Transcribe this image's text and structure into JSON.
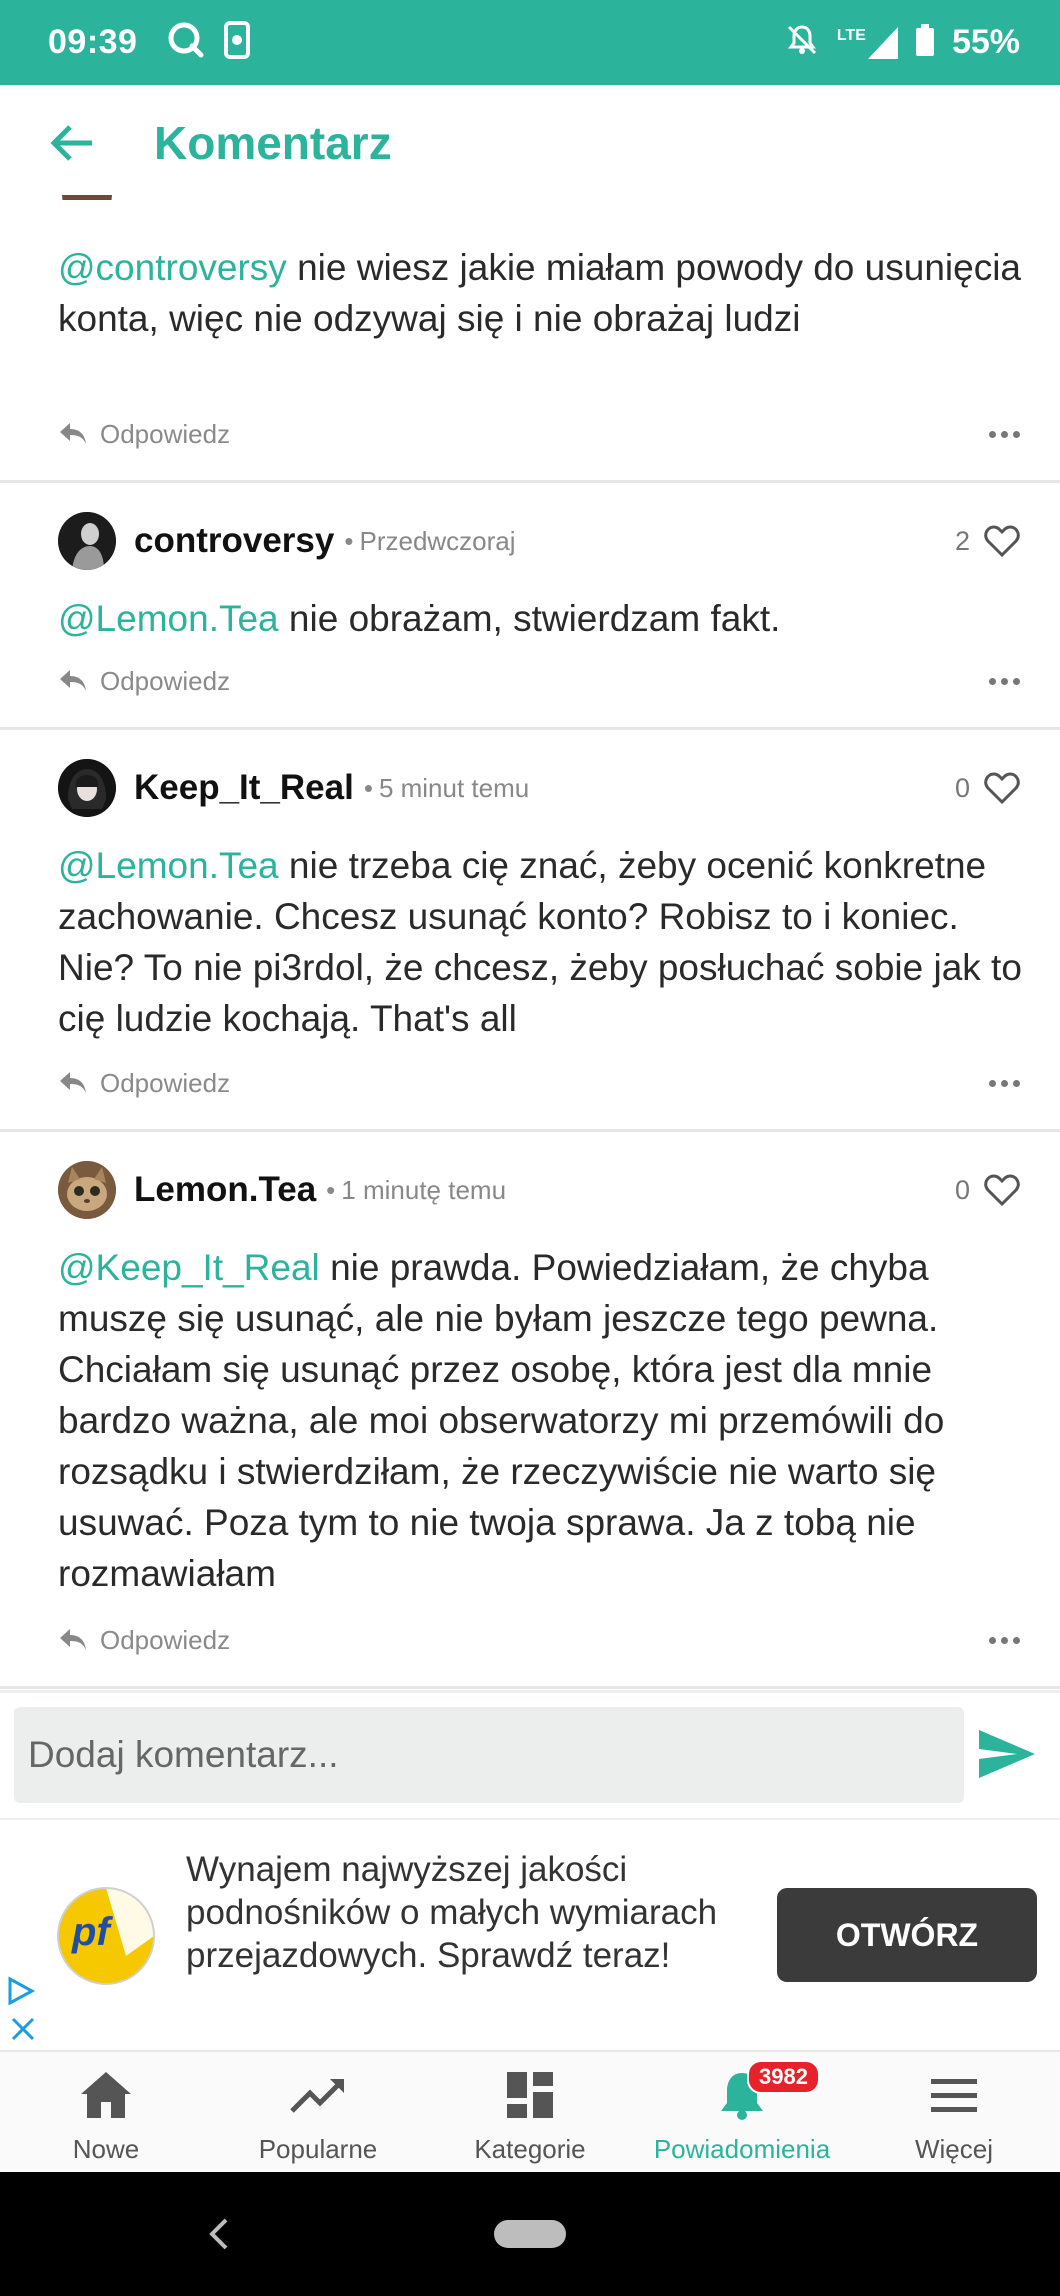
{
  "status_bar": {
    "time": "09:39",
    "network": "LTE",
    "battery": "55%"
  },
  "header": {
    "title": "Komentarz"
  },
  "comments": [
    {
      "mention": "@controversy",
      "text": " nie wiesz jakie miałam powody do usunięcia konta, więc nie odzywaj się i nie obrażaj ludzi",
      "reply_label": "Odpowiedz"
    },
    {
      "author": "controversy",
      "time": "Przedwczoraj",
      "likes": "2",
      "mention": "@Lemon.Tea",
      "text": " nie obrażam, stwierdzam fakt.",
      "reply_label": "Odpowiedz"
    },
    {
      "author": "Keep_It_Real",
      "time": "5 minut temu",
      "likes": "0",
      "mention": "@Lemon.Tea",
      "text": " nie trzeba cię znać, żeby ocenić konkretne zachowanie. Chcesz usunąć konto? Robisz to i koniec. Nie? To nie pi3rdol, że chcesz, żeby posłuchać sobie jak to cię ludzie kochają. That's all",
      "reply_label": "Odpowiedz"
    },
    {
      "author": "Lemon.Tea",
      "time": "1 minutę temu",
      "likes": "0",
      "mention": "@Keep_It_Real",
      "text": " nie prawda. Powiedziałam, że chyba muszę się usunąć, ale nie byłam jeszcze tego pewna. Chciałam się usunąć przez osobę, która jest dla mnie bardzo ważna, ale moi obserwatorzy mi przemówili do rozsądku i stwierdziłam, że rzeczywiście nie warto się usuwać. Poza tym to nie twoja sprawa. Ja z tobą nie rozmawiałam",
      "reply_label": "Odpowiedz"
    }
  ],
  "comment_input": {
    "placeholder": "Dodaj komentarz..."
  },
  "ad": {
    "logo_text": "pf",
    "text": "Wynajem najwyższej jakości podnośników o małych wymiarach przejazdowych. Sprawdź teraz!",
    "button": "OTWÓRZ"
  },
  "bottom_nav": [
    {
      "label": "Nowe",
      "icon": "home-icon"
    },
    {
      "label": "Popularne",
      "icon": "trending-icon"
    },
    {
      "label": "Kategorie",
      "icon": "grid-icon"
    },
    {
      "label": "Powiadomienia",
      "icon": "bell-icon",
      "badge": "3982",
      "active": true
    },
    {
      "label": "Więcej",
      "icon": "menu-icon"
    }
  ],
  "colors": {
    "accent": "#2bb39c",
    "badge": "#e8222a"
  }
}
